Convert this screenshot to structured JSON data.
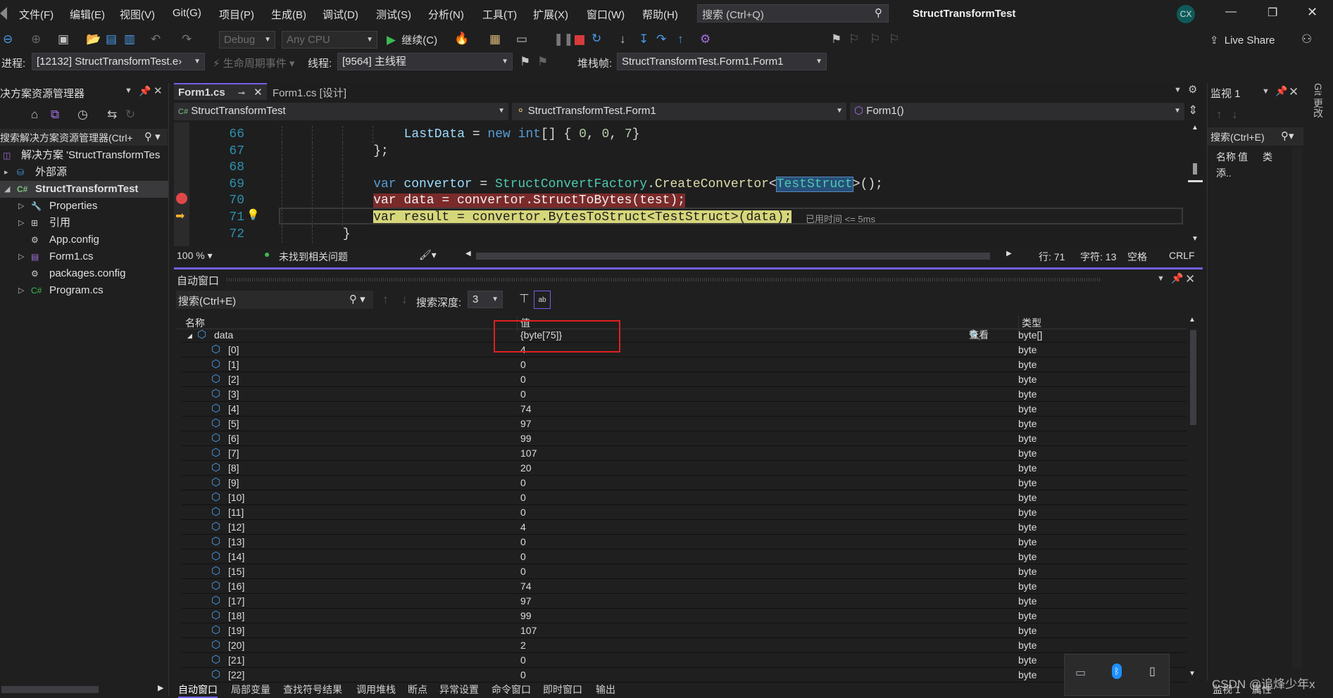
{
  "menu": {
    "items": [
      "文件(F)",
      "编辑(E)",
      "视图(V)",
      "Git(G)",
      "项目(P)",
      "生成(B)",
      "调试(D)",
      "测试(S)",
      "分析(N)",
      "工具(T)",
      "扩展(X)",
      "窗口(W)",
      "帮助(H)"
    ],
    "search_placeholder": "搜索 (Ctrl+Q)",
    "window_title": "StructTransformTest",
    "avatar": "CX"
  },
  "toolbar": {
    "config": "Debug",
    "platform": "Any CPU",
    "continue_label": "继续(C)",
    "live_share": "Live Share"
  },
  "debug_location": {
    "process_label": "进程:",
    "process": "[12132] StructTransformTest.e›",
    "lifecycle": "生命周期事件",
    "thread_label": "线程:",
    "thread": "[9564] 主线程",
    "stack_label": "堆栈帧:",
    "stack": "StructTransformTest.Form1.Form1"
  },
  "solution_explorer": {
    "title": "决方案资源管理器",
    "search_placeholder": "搜索解决方案资源管理器(Ctrl+",
    "items": [
      {
        "label": "解决方案 'StructTransformTes",
        "icon": "solution-icon"
      },
      {
        "label": "外部源",
        "icon": "external-sources-icon"
      },
      {
        "label": "StructTransformTest",
        "icon": "csharp-project-icon"
      },
      {
        "label": "Properties",
        "icon": "wrench-icon"
      },
      {
        "label": "引用",
        "icon": "references-icon"
      },
      {
        "label": "App.config",
        "icon": "config-icon"
      },
      {
        "label": "Form1.cs",
        "icon": "form-icon"
      },
      {
        "label": "packages.config",
        "icon": "config-icon"
      },
      {
        "label": "Program.cs",
        "icon": "csharp-file-icon"
      }
    ]
  },
  "editor": {
    "tabs": [
      {
        "label": "Form1.cs",
        "active": true
      },
      {
        "label": "Form1.cs [设计]",
        "active": false
      }
    ],
    "nav": {
      "project": "StructTransformTest",
      "class": "StructTransformTest.Form1",
      "member": "Form1()"
    },
    "lines": [
      {
        "n": "66",
        "indent": 4,
        "tokens": [
          {
            "t": "LastData",
            "c": "va"
          },
          {
            "t": " = ",
            "c": "pl"
          },
          {
            "t": "new",
            "c": "kw"
          },
          {
            "t": " ",
            "c": "pl"
          },
          {
            "t": "int",
            "c": "kw"
          },
          {
            "t": "[] { ",
            "c": "pl"
          },
          {
            "t": "0",
            "c": "nu"
          },
          {
            "t": ", ",
            "c": "pl"
          },
          {
            "t": "0",
            "c": "nu"
          },
          {
            "t": ", ",
            "c": "pl"
          },
          {
            "t": "7",
            "c": "nu"
          },
          {
            "t": "}",
            "c": "pl"
          }
        ]
      },
      {
        "n": "67",
        "indent": 3,
        "tokens": [
          {
            "t": "};",
            "c": "pl"
          }
        ]
      },
      {
        "n": "68",
        "indent": 3,
        "tokens": []
      },
      {
        "n": "69",
        "indent": 3,
        "tokens": [
          {
            "t": "var",
            "c": "kw"
          },
          {
            "t": " convertor",
            "c": "va"
          },
          {
            "t": " = ",
            "c": "pl"
          },
          {
            "t": "StructConvertFactory",
            "c": "ty"
          },
          {
            "t": ".",
            "c": "pl"
          },
          {
            "t": "CreateConvertor",
            "c": "fn"
          },
          {
            "t": "<",
            "c": "pl"
          },
          {
            "t": "TestStruct",
            "c": "ty sel"
          },
          {
            "t": ">();",
            "c": "pl"
          }
        ]
      },
      {
        "n": "70",
        "indent": 3,
        "tokens": [
          {
            "t": "var data = convertor.StructToBytes(test);",
            "c": "bp"
          }
        ]
      },
      {
        "n": "71",
        "indent": 3,
        "tokens": [
          {
            "t": "var result = convertor.BytesToStruct<TestStruct>(data);",
            "c": "cur"
          }
        ]
      },
      {
        "n": "72",
        "indent": 2,
        "tokens": [
          {
            "t": "}",
            "c": "pl"
          }
        ]
      }
    ],
    "elapsed": "已用时间 <= 5ms",
    "status": {
      "zoom": "100 %",
      "issues": "未找到相关问题",
      "line": "行: 71",
      "char": "字符: 13",
      "spaces": "空格",
      "eol": "CRLF"
    }
  },
  "watch": {
    "title": "监视 1",
    "search_placeholder": "搜索(Ctrl+E)",
    "col_name": "名称",
    "col_value": "值",
    "col_type": "类",
    "add_placeholder": "添.."
  },
  "git_side_tab": "Git 更改",
  "autos": {
    "title": "自动窗口",
    "search_placeholder": "搜索(Ctrl+E)",
    "depth_label": "搜索深度:",
    "depth": "3",
    "columns": {
      "name": "名称",
      "value": "值",
      "type": "类型"
    },
    "view_label": "查看",
    "root": {
      "name": "data",
      "value": "{byte[75]}",
      "type": "byte[]"
    },
    "children_type": "byte",
    "children": [
      "4",
      "0",
      "0",
      "0",
      "74",
      "97",
      "99",
      "107",
      "20",
      "0",
      "0",
      "0",
      "4",
      "0",
      "0",
      "0",
      "74",
      "97",
      "99",
      "107",
      "2",
      "0",
      "0"
    ]
  },
  "bottom_tabs": [
    "自动窗口",
    "局部变量",
    "查找符号结果",
    "调用堆栈",
    "断点",
    "异常设置",
    "命令窗口",
    "即时窗口",
    "输出"
  ],
  "right_bottom_tabs": [
    "监视 1",
    "属性"
  ],
  "watermark": "CSDN @追烽少年x",
  "colors": {
    "accent": "#7160e8",
    "breakpoint": "#e51400",
    "current_line": "#d6d67a",
    "highlight_box": "#e02020"
  }
}
